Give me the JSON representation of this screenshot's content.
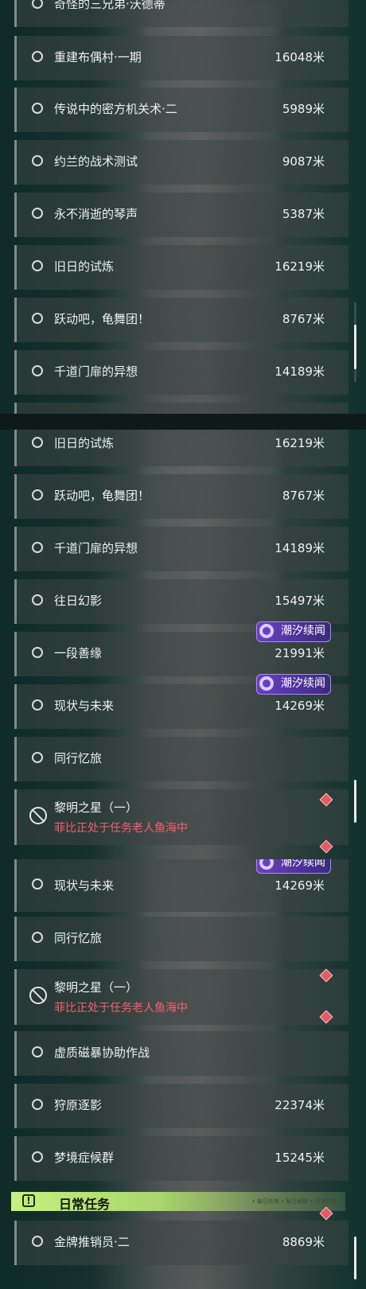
{
  "panel1": {
    "partial_top": {
      "title": "奇怪的三兄弟·沃德蒂"
    },
    "rows": [
      {
        "title": "重建布偶村·一期",
        "distance": "16048米"
      },
      {
        "title": "传说中的密方机关术·二",
        "distance": "5989米"
      },
      {
        "title": "约兰的战术测试",
        "distance": "9087米"
      },
      {
        "title": "永不消逝的琴声",
        "distance": "5387米"
      },
      {
        "title": "旧日的试炼",
        "distance": "16219米"
      },
      {
        "title": "跃动吧，龟舞团！",
        "distance": "8767米"
      },
      {
        "title": "千道门扉的异想",
        "distance": "14189米"
      }
    ]
  },
  "panel2": {
    "rows": [
      {
        "title": "旧日的试炼",
        "distance": "16219米"
      },
      {
        "title": "跃动吧，龟舞团！",
        "distance": "8767米"
      },
      {
        "title": "千道门扉的异想",
        "distance": "14189米"
      },
      {
        "title": "往日幻影",
        "distance": "15497米"
      },
      {
        "title": "一段善缘",
        "distance": "21991米",
        "badge": "潮汐续闻"
      },
      {
        "title": "现状与未来",
        "distance": "14269米",
        "badge": "潮汐续闻"
      },
      {
        "title": "同行忆旅",
        "distance": ""
      }
    ],
    "blocked": {
      "title": "黎明之星（一）",
      "status": "菲比正处于任务老人鱼海中"
    }
  },
  "panel3": {
    "rows_top": [
      {
        "title": "现状与未来",
        "distance": "14269米",
        "badge": "潮汐续闻"
      },
      {
        "title": "同行忆旅",
        "distance": ""
      }
    ],
    "blocked": {
      "title": "黎明之星（一）",
      "status": "菲比正处于任务老人鱼海中"
    },
    "rows_bottom": [
      {
        "title": "虚质磁暴协助作战",
        "distance": ""
      },
      {
        "title": "狩原逐影",
        "distance": "22374米"
      },
      {
        "title": "梦境症候群",
        "distance": "15245米"
      }
    ],
    "daily_header": {
      "title": "日常任务",
      "icon": "exclamation-icon",
      "note": "• 每日任务 • 每日刷新 • 日常任务"
    },
    "daily_rows": [
      {
        "title": "金牌推销员·二",
        "distance": "8869米"
      }
    ]
  },
  "colors": {
    "badge": "#6a3fc2",
    "warning_text": "#ff5c6a",
    "daily_header": "#c7f07e"
  }
}
